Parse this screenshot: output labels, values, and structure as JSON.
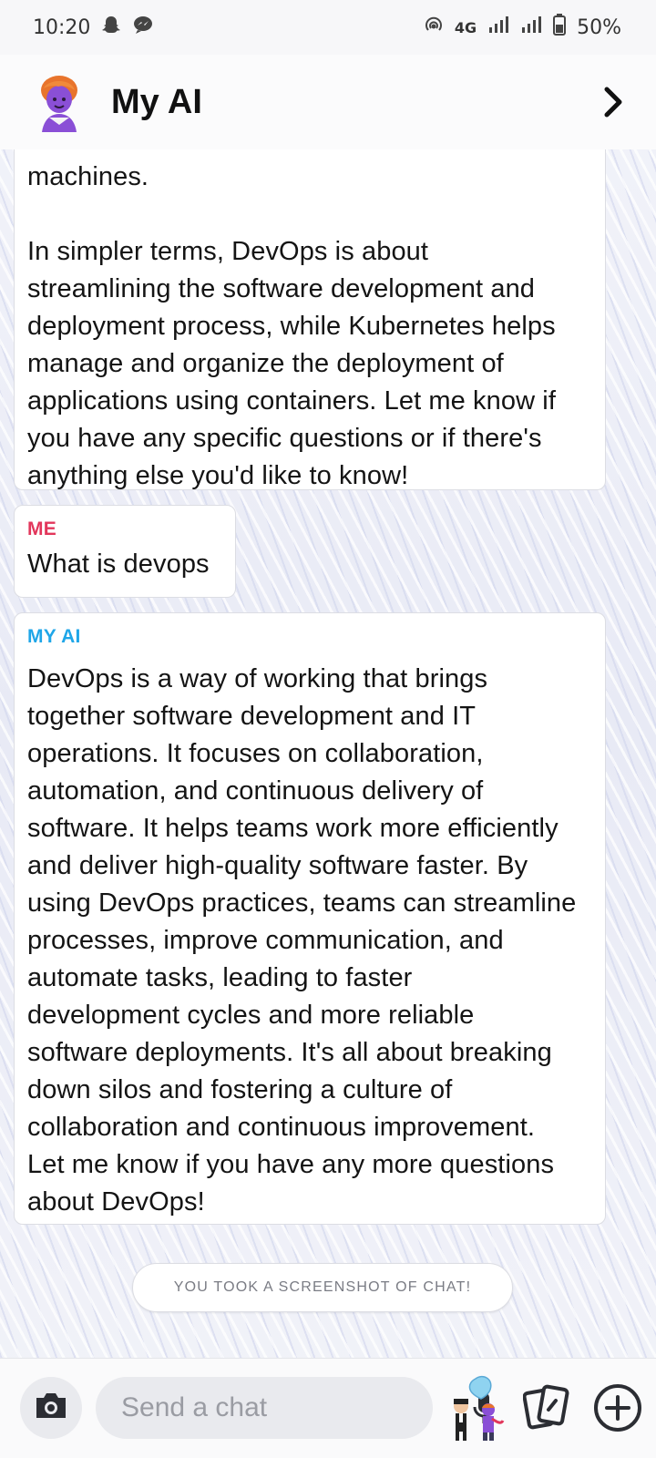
{
  "status_bar": {
    "time": "10:20",
    "network": "4G",
    "battery": "50%",
    "icons": [
      "snapchat-ghost-icon",
      "messenger-icon",
      "hotspot-icon",
      "signal-icon",
      "signal-icon",
      "battery-icon"
    ]
  },
  "header": {
    "title": "My AI",
    "avatar": "bitmoji-avatar",
    "next_icon": "chevron-right-icon"
  },
  "messages": [
    {
      "sender": "",
      "text": "machines.\n\nIn simpler terms, DevOps is about\nstreamlining the software development and\ndeployment process, while Kubernetes helps\nmanage and organize the deployment of\napplications using containers. Let me know if\nyou have any specific questions or if there's\nanything else you'd like to know!"
    },
    {
      "sender": "ME",
      "text": "What is devops"
    },
    {
      "sender": "MY AI",
      "text": "DevOps is a way of working that brings\ntogether software development and IT\noperations. It focuses on collaboration,\nautomation, and continuous delivery of\nsoftware. It helps teams work more efficiently\nand deliver high-quality software faster. By\nusing DevOps practices, teams can streamline\nprocesses, improve communication, and\nautomate tasks, leading to faster\ndevelopment cycles and more reliable\nsoftware deployments. It's all about breaking\ndown silos and fostering a culture of\ncollaboration and continuous improvement.\nLet me know if you have any more questions\nabout DevOps!"
    }
  ],
  "screenshot_notice": "YOU TOOK A SCREENSHOT OF CHAT!",
  "composer": {
    "placeholder": "Send a chat",
    "icons": [
      "camera-icon",
      "microphone-icon",
      "bitmoji-sticker-icon",
      "cards-icon",
      "plus-icon"
    ]
  },
  "colors": {
    "me": "#e2365b",
    "ai": "#1fa6e8",
    "bubble": "#ffffff",
    "background": "#eef0f8"
  }
}
